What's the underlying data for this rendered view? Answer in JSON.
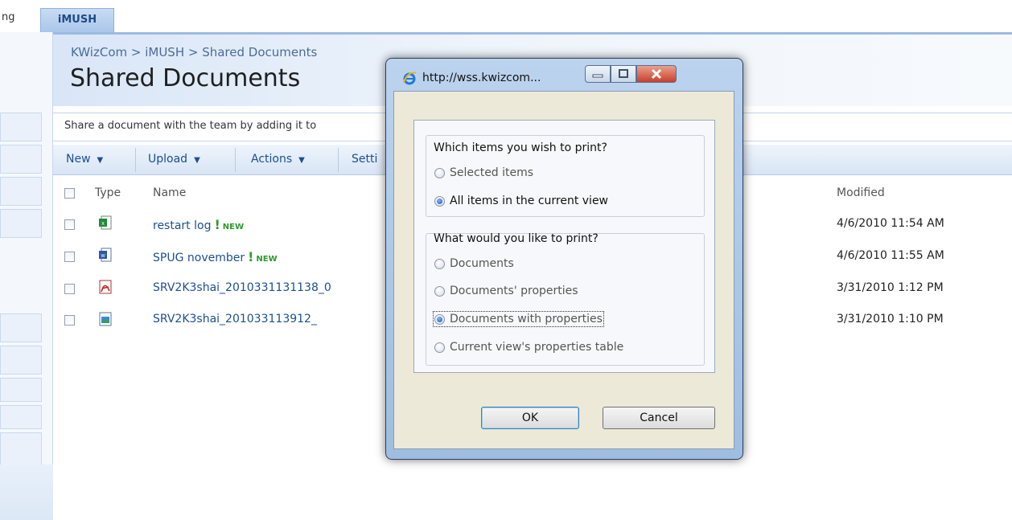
{
  "topnav": {
    "prev_tab": "ng",
    "active_tab": "iMUSH"
  },
  "breadcrumb": "KWizCom > iMUSH > Shared Documents",
  "page_title": "Shared Documents",
  "description": "Share a document with the team by adding it to",
  "toolbar": {
    "new_label": "New",
    "upload_label": "Upload",
    "actions_label": "Actions",
    "settings_label": "Setti"
  },
  "list": {
    "headers": {
      "type": "Type",
      "name": "Name",
      "modified": "Modified"
    },
    "new_tag": "NEW",
    "rows": [
      {
        "icon": "excel-icon",
        "name": "restart log",
        "is_new": true,
        "modified": "4/6/2010 11:54 AM"
      },
      {
        "icon": "word-icon",
        "name": "SPUG november",
        "is_new": true,
        "modified": "4/6/2010 11:55 AM"
      },
      {
        "icon": "pdf-icon",
        "name": "SRV2K3shai_2010331131138_0",
        "is_new": false,
        "modified": "3/31/2010 1:12 PM"
      },
      {
        "icon": "image-icon",
        "name": "SRV2K3shai_201033113912_",
        "is_new": false,
        "modified": "3/31/2010 1:10 PM"
      }
    ]
  },
  "dialog": {
    "title": "http://wss.kwizcom...",
    "group1": {
      "title": "Which items you wish to print?",
      "options": [
        "Selected items",
        "All items in the current view"
      ],
      "selected_index": 1
    },
    "group2": {
      "title": "What would you like to print?",
      "options": [
        "Documents",
        "Documents' properties",
        "Documents with properties",
        "Current view's properties table"
      ],
      "selected_index": 2
    },
    "ok_label": "OK",
    "cancel_label": "Cancel"
  },
  "colors": {
    "link": "#1d4f91",
    "new_tag": "#2b9a2b",
    "accent": "#9bbbe3"
  }
}
